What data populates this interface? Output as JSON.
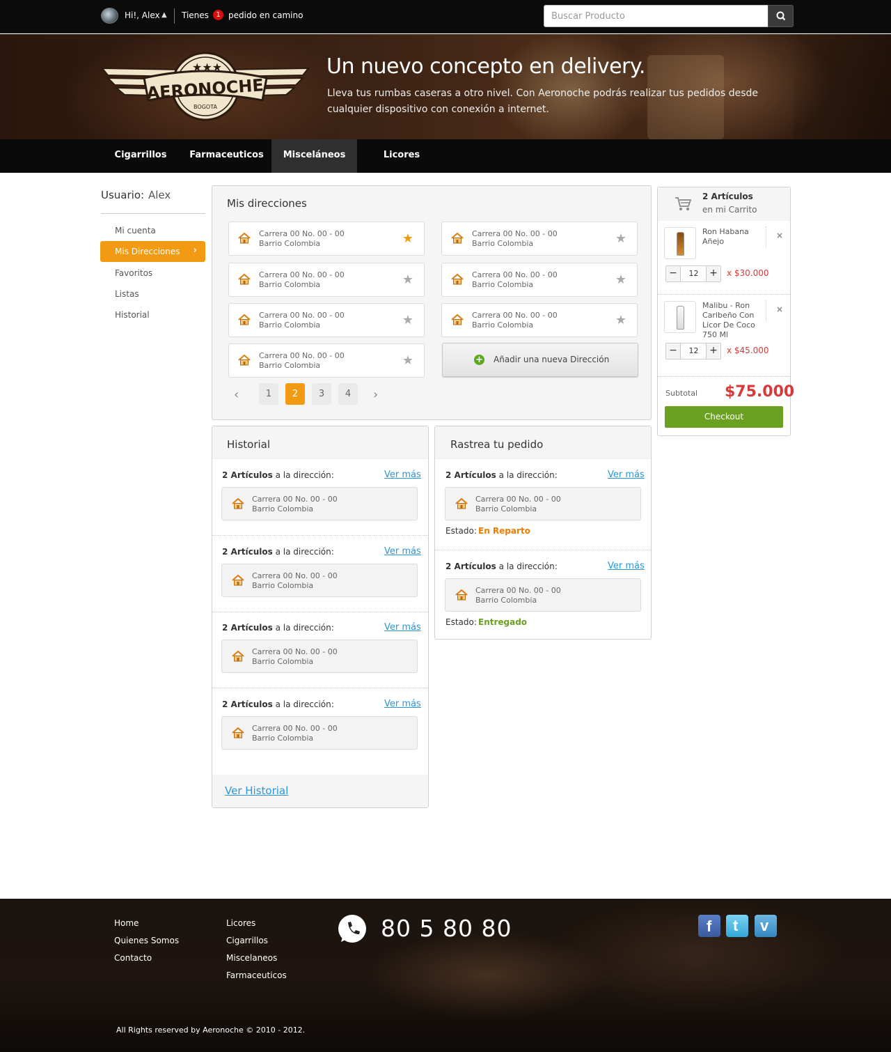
{
  "topbar": {
    "greeting": "Hi!, Alex",
    "tienes": "Tienes",
    "order_count": "1",
    "order_text": "pedido en camino",
    "search_placeholder": "Buscar Producto"
  },
  "hero": {
    "title": "Un nuevo concepto en delivery.",
    "text": "Lleva tus rumbas caseras a otro nivel. Con Aeronoche podrás realizar tus pedidos desde cualquier dispositivo con conexión a internet.",
    "logo_text": "AERONOCHE",
    "logo_sub": "BOGOTA"
  },
  "nav": {
    "items": [
      "Cigarrillos",
      "Farmaceuticos",
      "Misceláneos",
      "Licores"
    ],
    "active": "Misceláneos"
  },
  "sidebar": {
    "usuario_label": "Usuario:",
    "usuario_name": "Alex",
    "links": [
      "Mi cuenta",
      "Mis Direcciones",
      "Favoritos",
      "Listas",
      "Historial"
    ],
    "active": "Mis Direcciones"
  },
  "addresses": {
    "title": "Mis direcciones",
    "items": [
      {
        "line1": "Carrera 00 No. 00 - 00",
        "line2": "Barrio Colombia",
        "favorite": true
      },
      {
        "line1": "Carrera 00 No. 00 - 00",
        "line2": "Barrio Colombia",
        "favorite": false
      },
      {
        "line1": "Carrera 00 No. 00 - 00",
        "line2": "Barrio Colombia",
        "favorite": false
      },
      {
        "line1": "Carrera 00 No. 00 - 00",
        "line2": "Barrio Colombia",
        "favorite": false
      },
      {
        "line1": "Carrera 00 No. 00 - 00",
        "line2": "Barrio Colombia",
        "favorite": false
      },
      {
        "line1": "Carrera 00 No. 00 - 00",
        "line2": "Barrio Colombia",
        "favorite": false
      },
      {
        "line1": "Carrera 00 No. 00 - 00",
        "line2": "Barrio Colombia",
        "favorite": false
      }
    ],
    "add_label": "Añadir una nueva Dirección",
    "pages": [
      "1",
      "2",
      "3",
      "4"
    ],
    "current_page": "2"
  },
  "historial": {
    "title": "Historial",
    "entries": [
      {
        "count": "2 Artículos",
        "label": "a la dirección:",
        "link": "Ver más",
        "line1": "Carrera 00 No. 00 - 00",
        "line2": "Barrio Colombia"
      },
      {
        "count": "2 Artículos",
        "label": "a la dirección:",
        "link": "Ver más",
        "line1": "Carrera 00 No. 00 - 00",
        "line2": "Barrio Colombia"
      },
      {
        "count": "2 Artículos",
        "label": "a la dirección:",
        "link": "Ver más",
        "line1": "Carrera 00 No. 00 - 00",
        "line2": "Barrio Colombia"
      },
      {
        "count": "2 Artículos",
        "label": "a la dirección:",
        "link": "Ver más",
        "line1": "Carrera 00 No. 00 - 00",
        "line2": "Barrio Colombia"
      }
    ],
    "footer_link": "Ver Historial"
  },
  "tracking": {
    "title": "Rastrea tu pedido",
    "estado_label": "Estado:",
    "entries": [
      {
        "count": "2 Artículos",
        "label": "a la dirección:",
        "link": "Ver más",
        "line1": "Carrera 00 No. 00 - 00",
        "line2": "Barrio Colombia",
        "status": "En Reparto",
        "status_color": "#f07d00"
      },
      {
        "count": "2 Artículos",
        "label": "a la dirección:",
        "link": "Ver más",
        "line1": "Carrera 00 No. 00 - 00",
        "line2": "Barrio Colombia",
        "status": "Entregado",
        "status_color": "#6aa122"
      }
    ]
  },
  "cart": {
    "count_label": "2 Artículos",
    "sub_label": "en mi Carrito",
    "items": [
      {
        "name": "Ron Habana Añejo",
        "qty": "12",
        "price": "x $30.000"
      },
      {
        "name": "Malibu - Ron Caribeño Con Licor De Coco 750 Ml",
        "qty": "12",
        "price": "x $45.000"
      }
    ],
    "subtotal_label": "Subtotal",
    "subtotal": "$75.000",
    "checkout_label": "Checkout"
  },
  "footer": {
    "col1": [
      "Home",
      "Quienes Somos",
      "Contacto"
    ],
    "col2": [
      "Licores",
      "Cigarrillos",
      "Miscelaneos",
      "Farmaceuticos"
    ],
    "phone": "80 5 80 80",
    "copyright": "All Rights reserved by Aeronoche © 2010 - 2012.",
    "social": [
      "facebook-icon",
      "twitter-icon",
      "vimeo-icon"
    ]
  },
  "colors": {
    "accent": "#f39a13",
    "link": "#2a96d9",
    "price": "#d63a3a",
    "checkout": "#6aa122",
    "badge": "#d80f0f"
  }
}
